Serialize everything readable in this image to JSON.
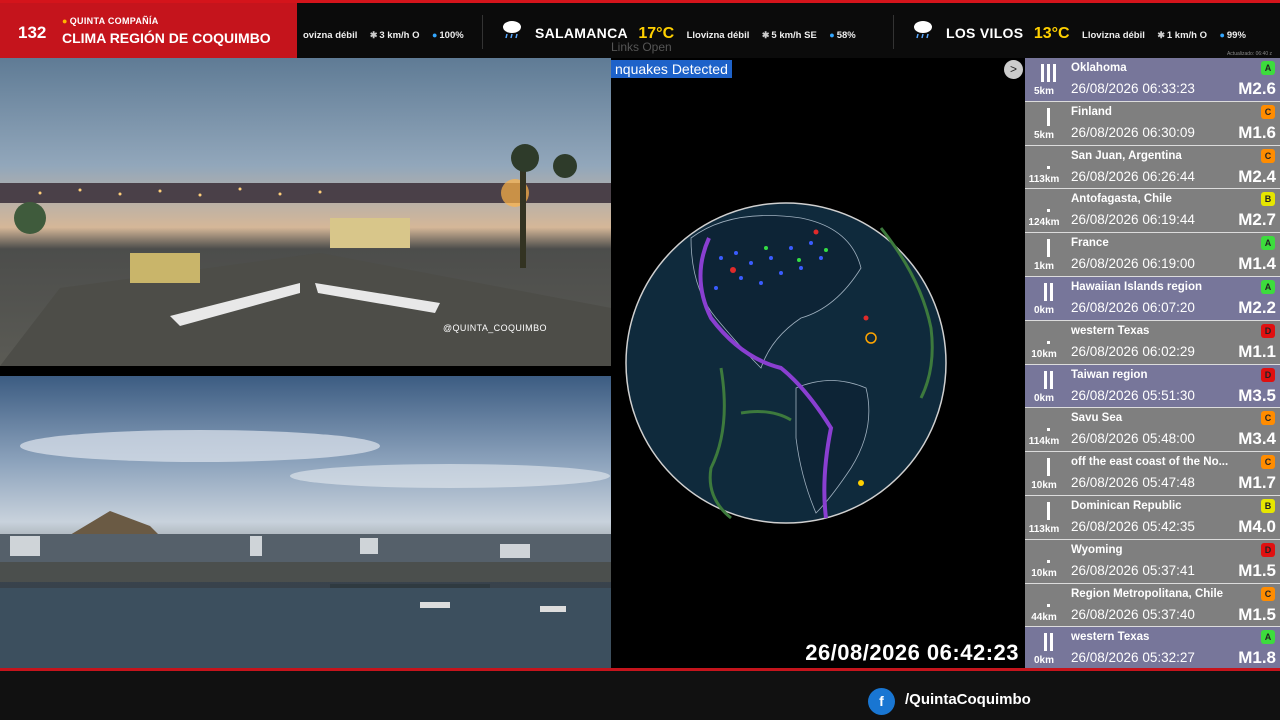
{
  "header": {
    "number": "132",
    "subtitle": "QUINTA COMPAÑÍA",
    "title": "CLIMA REGIÓN DE COQUIMBO",
    "updated": "Actualizado: 06:40 z"
  },
  "weather": [
    {
      "city": "",
      "temp": "",
      "condition": "ovizna débil",
      "wind": "3 km/h O",
      "humidity": "100%"
    },
    {
      "city": "SALAMANCA",
      "temp": "17°C",
      "condition": "Llovizna débil",
      "wind": "5 km/h SE",
      "humidity": "58%"
    },
    {
      "city": "LOS VILOS",
      "temp": "13°C",
      "condition": "Llovizna débil",
      "wind": "1 km/h O",
      "humidity": "99%"
    }
  ],
  "camera": {
    "label": "@QUINTA_COQUIMBO"
  },
  "quake_map": {
    "ghost_text": "Links   Open",
    "title": "nquakes Detected",
    "next_icon": ">",
    "clock": "26/08/2026 06:42:23"
  },
  "quakes": [
    {
      "place": "Oklahoma",
      "time": "26/08/2026 06:33:23",
      "mag": "M2.6",
      "depth": "5km",
      "grade": "A",
      "grade_color": "#3ddc3d",
      "bars": 3,
      "row": "purple"
    },
    {
      "place": "Finland",
      "time": "26/08/2026 06:30:09",
      "mag": "M1.6",
      "depth": "5km",
      "grade": "C",
      "grade_color": "#ff8c00",
      "bars": 1,
      "row": "gray"
    },
    {
      "place": "San Juan, Argentina",
      "time": "26/08/2026 06:26:44",
      "mag": "M2.4",
      "depth": "113km",
      "grade": "C",
      "grade_color": "#ff8c00",
      "bars": 0,
      "row": "gray"
    },
    {
      "place": "Antofagasta, Chile",
      "time": "26/08/2026 06:19:44",
      "mag": "M2.7",
      "depth": "124km",
      "grade": "B",
      "grade_color": "#e6e600",
      "bars": 0,
      "row": "gray"
    },
    {
      "place": "France",
      "time": "26/08/2026 06:19:00",
      "mag": "M1.4",
      "depth": "1km",
      "grade": "A",
      "grade_color": "#3ddc3d",
      "bars": 1,
      "row": "gray"
    },
    {
      "place": "Hawaiian Islands region",
      "time": "26/08/2026 06:07:20",
      "mag": "M2.2",
      "depth": "0km",
      "grade": "A",
      "grade_color": "#3ddc3d",
      "bars": 2,
      "row": "purple"
    },
    {
      "place": "western Texas",
      "time": "26/08/2026 06:02:29",
      "mag": "M1.1",
      "depth": "10km",
      "grade": "D",
      "grade_color": "#e01010",
      "bars": 0,
      "row": "gray"
    },
    {
      "place": "Taiwan region",
      "time": "26/08/2026 05:51:30",
      "mag": "M3.5",
      "depth": "0km",
      "grade": "D",
      "grade_color": "#e01010",
      "bars": 2,
      "row": "purple"
    },
    {
      "place": "Savu Sea",
      "time": "26/08/2026 05:48:00",
      "mag": "M3.4",
      "depth": "114km",
      "grade": "C",
      "grade_color": "#ff8c00",
      "bars": 0,
      "row": "gray"
    },
    {
      "place": "off the east coast of the No...",
      "time": "26/08/2026 05:47:48",
      "mag": "M1.7",
      "depth": "10km",
      "grade": "C",
      "grade_color": "#ff8c00",
      "bars": 1,
      "row": "gray"
    },
    {
      "place": "Dominican Republic",
      "time": "26/08/2026 05:42:35",
      "mag": "M4.0",
      "depth": "113km",
      "grade": "B",
      "grade_color": "#e6e600",
      "bars": 1,
      "row": "gray"
    },
    {
      "place": "Wyoming",
      "time": "26/08/2026 05:37:41",
      "mag": "M1.5",
      "depth": "10km",
      "grade": "D",
      "grade_color": "#e01010",
      "bars": 0,
      "row": "gray"
    },
    {
      "place": "Region Metropolitana, Chile",
      "time": "26/08/2026 05:37:40",
      "mag": "M1.5",
      "depth": "44km",
      "grade": "C",
      "grade_color": "#ff8c00",
      "bars": 0,
      "row": "gray"
    },
    {
      "place": "western Texas",
      "time": "26/08/2026 05:32:27",
      "mag": "M1.8",
      "depth": "0km",
      "grade": "A",
      "grade_color": "#3ddc3d",
      "bars": 2,
      "row": "purple"
    }
  ],
  "footer": {
    "facebook_icon": "f",
    "handle": "/QuintaCoquimbo"
  }
}
